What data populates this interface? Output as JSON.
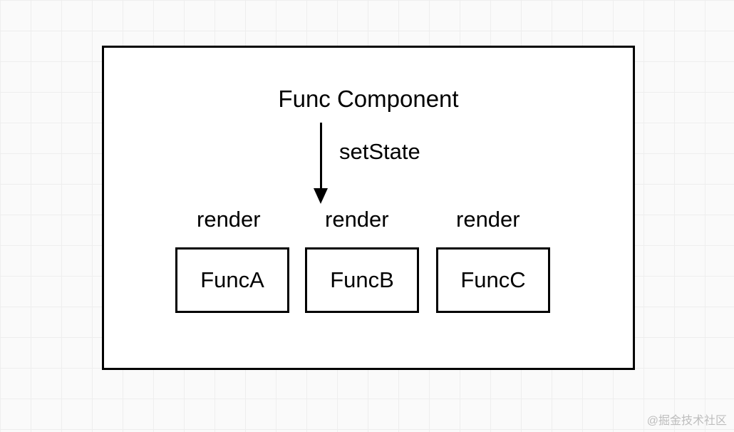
{
  "diagram": {
    "title": "Func Component",
    "action_label": "setState",
    "children": [
      {
        "render_label": "render",
        "name": "FuncA"
      },
      {
        "render_label": "render",
        "name": "FuncB"
      },
      {
        "render_label": "render",
        "name": "FuncC"
      }
    ]
  },
  "watermark": "@掘金技术社区"
}
